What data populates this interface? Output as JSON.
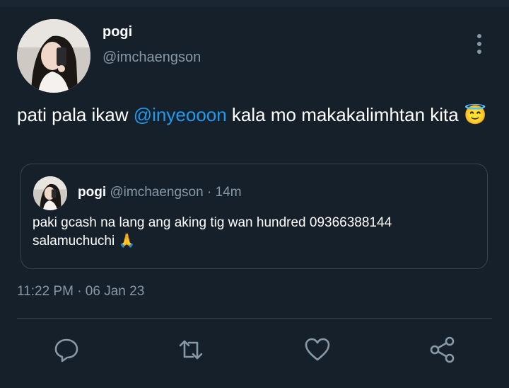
{
  "tweet": {
    "author_name": "pogi",
    "author_handle": "@imchaengson",
    "text_before": "pati pala ikaw ",
    "mention": "@inyeooon",
    "text_after": " kala mo makakalimhtan kita ",
    "emoji": "😇",
    "timestamp": "11:22 PM · 06 Jan 23"
  },
  "quoted_tweet": {
    "author_name": "pogi",
    "author_handle": "@imchaengson",
    "time": "· 14m",
    "text": "paki gcash na lang ang aking tig wan hundred 09366388144 salamuchuchi ",
    "emoji": "🙏"
  },
  "actions": [
    "reply-icon",
    "retweet-icon",
    "like-icon",
    "share-icon"
  ],
  "colors": {
    "background": "#15202b",
    "accent": "#1d9bf0",
    "muted": "#8899a6",
    "border": "#38444d"
  }
}
